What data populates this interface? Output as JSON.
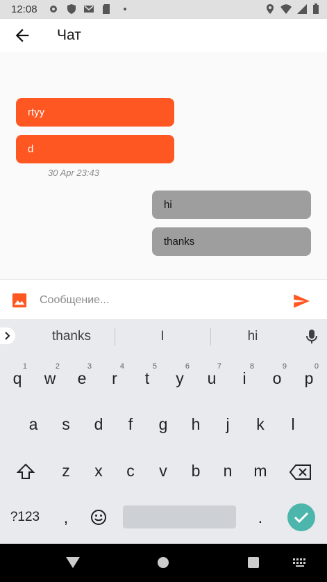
{
  "status_bar": {
    "time": "12:08"
  },
  "app_bar": {
    "title": "Чат"
  },
  "messages": {
    "outgoing": [
      "rtyy",
      "d"
    ],
    "timestamp": "30 Apr 23:43",
    "incoming": [
      "hi",
      "thanks"
    ]
  },
  "composer": {
    "placeholder": "Сообщение..."
  },
  "keyboard": {
    "suggestions": [
      "thanks",
      "I",
      "hi"
    ],
    "row1": [
      "q",
      "w",
      "e",
      "r",
      "t",
      "y",
      "u",
      "i",
      "o",
      "p"
    ],
    "row1_hints": [
      "1",
      "2",
      "3",
      "4",
      "5",
      "6",
      "7",
      "8",
      "9",
      "0"
    ],
    "row2": [
      "a",
      "s",
      "d",
      "f",
      "g",
      "h",
      "j",
      "k",
      "l"
    ],
    "row3": [
      "z",
      "x",
      "c",
      "v",
      "b",
      "n",
      "m"
    ],
    "symbols_label": "?123",
    "comma": ",",
    "period": "."
  },
  "colors": {
    "accent": "#ff5722",
    "incoming_bubble": "#9e9e9e",
    "done_key": "#4db6ac"
  }
}
